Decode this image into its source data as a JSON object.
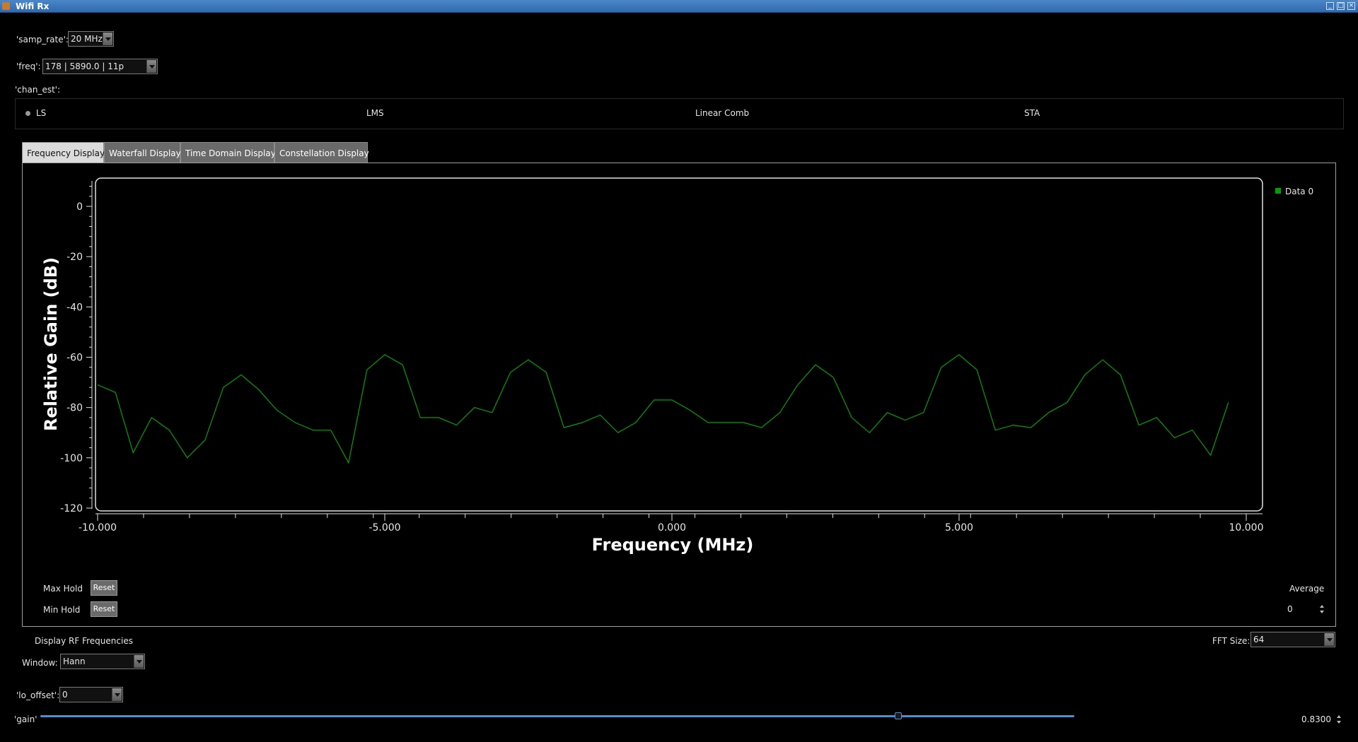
{
  "window": {
    "title": "Wifi Rx",
    "title_color": "#2f6aad"
  },
  "controls": {
    "samp_rate": {
      "label": "'samp_rate':",
      "value": "20 MHz"
    },
    "freq": {
      "label": "'freq':",
      "value": "178 | 5890.0 | 11p"
    },
    "chan_est": {
      "label": "'chan_est':",
      "options": [
        "LS",
        "LMS",
        "Linear Comb",
        "STA"
      ],
      "selected": "LS"
    }
  },
  "tabs": [
    {
      "label": "Frequency Display",
      "active": true
    },
    {
      "label": "Waterfall Display",
      "active": false
    },
    {
      "label": "Time Domain Display",
      "active": false
    },
    {
      "label": "Constellation Display",
      "active": false
    }
  ],
  "plot": {
    "legend": "Data 0",
    "line_color": "#00a000",
    "max_hold_label": "Max Hold",
    "min_hold_label": "Min Hold",
    "reset_label": "Reset",
    "average_label": "Average",
    "average_value": "0"
  },
  "chart_data": {
    "type": "line",
    "xlabel": "Frequency (MHz)",
    "ylabel": "Relative Gain (dB)",
    "xlim": [
      -10,
      10
    ],
    "ylim": [
      -120,
      10
    ],
    "x_ticks": [
      "-10.000",
      "-5.000",
      "0.000",
      "5.000",
      "10.000"
    ],
    "y_ticks": [
      "0",
      "-20",
      "-40",
      "-60",
      "-80",
      "-100",
      "-120"
    ],
    "series": [
      {
        "name": "Data 0",
        "x": [
          -10.0,
          -9.69,
          -9.38,
          -9.06,
          -8.75,
          -8.44,
          -8.13,
          -7.81,
          -7.5,
          -7.19,
          -6.88,
          -6.56,
          -6.25,
          -5.94,
          -5.63,
          -5.31,
          -5.0,
          -4.69,
          -4.38,
          -4.06,
          -3.75,
          -3.44,
          -3.13,
          -2.81,
          -2.5,
          -2.19,
          -1.88,
          -1.56,
          -1.25,
          -0.94,
          -0.63,
          -0.31,
          0.0,
          0.31,
          0.63,
          0.94,
          1.25,
          1.56,
          1.88,
          2.19,
          2.5,
          2.81,
          3.13,
          3.44,
          3.75,
          4.06,
          4.38,
          4.69,
          5.0,
          5.31,
          5.63,
          5.94,
          6.25,
          6.56,
          6.88,
          7.19,
          7.5,
          7.81,
          8.13,
          8.44,
          8.75,
          9.06,
          9.38,
          9.69
        ],
        "y": [
          -71,
          -74,
          -98,
          -84,
          -89,
          -100,
          -93,
          -72,
          -67,
          -73,
          -81,
          -86,
          -89,
          -89,
          -102,
          -65,
          -59,
          -63,
          -84,
          -84,
          -87,
          -80,
          -82,
          -66,
          -61,
          -66,
          -88,
          -86,
          -83,
          -90,
          -86,
          -77,
          -77,
          -81,
          -86,
          -86,
          -86,
          -88,
          -82,
          -71,
          -63,
          -68,
          -84,
          -90,
          -82,
          -85,
          -82,
          -64,
          -59,
          -65,
          -89,
          -87,
          -88,
          -82,
          -78,
          -67,
          -61,
          -67,
          -87,
          -84,
          -92,
          -89,
          -99,
          -78
        ]
      }
    ]
  },
  "bottom": {
    "display_rf": "Display RF Frequencies",
    "fft_label": "FFT Size:",
    "fft_value": "64",
    "window_label": "Window:",
    "window_value": "Hann",
    "lo_offset_label": "'lo_offset':",
    "lo_offset_value": "0",
    "gain_label": "'gain'",
    "gain_value": "0.8300",
    "gain_fraction": 0.83
  }
}
